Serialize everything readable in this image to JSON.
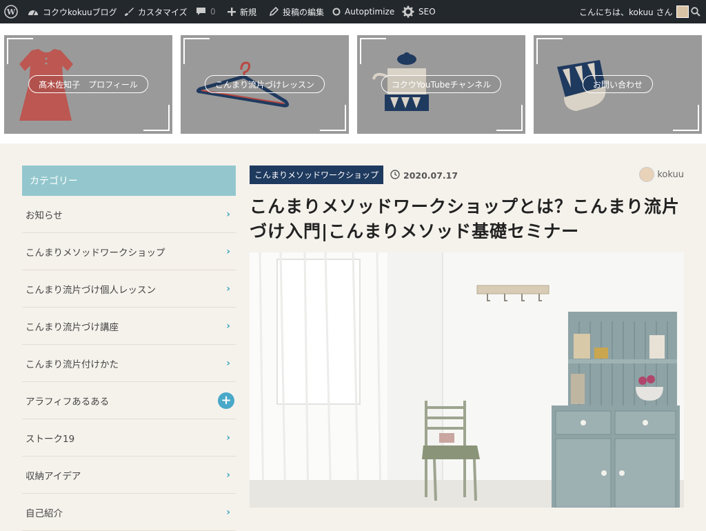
{
  "adminbar": {
    "site_name": "コクウkokuuブログ",
    "customize": "カスタマイズ",
    "comments_count": "0",
    "new": "新規",
    "edit_post": "投稿の編集",
    "autoptimize": "Autoptimize",
    "seo": "SEO",
    "greeting": "こんにちは、kokuu さん"
  },
  "banners": [
    {
      "label": "髙木佐知子　プロフィール"
    },
    {
      "label": "こんまり流片づけレッスン"
    },
    {
      "label": "コクウYouTubeチャンネル"
    },
    {
      "label": "お問い合わせ"
    }
  ],
  "sidebar": {
    "heading": "カテゴリー",
    "items": [
      {
        "label": "お知らせ"
      },
      {
        "label": "こんまりメソッドワークショップ"
      },
      {
        "label": "こんまり流片づけ個人レッスン"
      },
      {
        "label": "こんまり流片づけ講座"
      },
      {
        "label": "こんまり流片付けかた"
      },
      {
        "label": "アラフィフあるある"
      },
      {
        "label": "ストーク19"
      },
      {
        "label": "収納アイデア"
      },
      {
        "label": "自己紹介"
      }
    ]
  },
  "article": {
    "category": "こんまりメソッドワークショップ",
    "date": "2020.07.17",
    "author": "kokuu",
    "title": "こんまりメソッドワークショップとは？こんまり流片づけ入門|こんまりメソッド基礎セミナー"
  },
  "colors": {
    "adminbar_bg": "#23282d",
    "sidebar_heading_bg": "#93c7cd",
    "category_badge_bg": "#1f3a5f",
    "accent_arrow": "#3aa4bd"
  }
}
